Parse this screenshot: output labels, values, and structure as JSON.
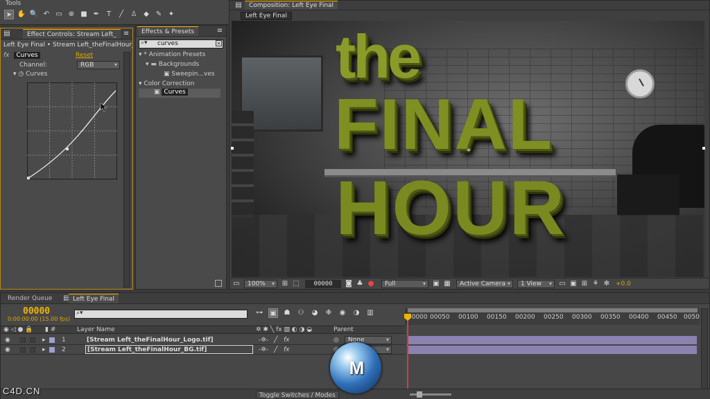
{
  "tools": {
    "title": "Tools",
    "icons": [
      "selection-tool-icon",
      "hand-tool-icon",
      "zoom-tool-icon",
      "rotate-tool-icon",
      "camera-tool-icon",
      "pan-behind-tool-icon",
      "rectangle-tool-icon",
      "pen-tool-icon",
      "text-tool-icon",
      "brush-tool-icon",
      "clone-stamp-tool-icon",
      "eraser-tool-icon",
      "roto-brush-tool-icon",
      "puppet-tool-icon"
    ]
  },
  "effect_controls": {
    "tab_label": "Effect Controls: Stream Left_",
    "breadcrumb": "Left Eye Final • Stream Left_theFinalHour_BG",
    "effect_name": "Curves",
    "reset_label": "Reset",
    "channel_label": "Channel:",
    "channel_value": "RGB",
    "curves_label": "Curves"
  },
  "effects_presets": {
    "tab_label": "Effects & Presets",
    "search_value": "curves",
    "tree": [
      {
        "label": "* Animation Presets",
        "level": 0
      },
      {
        "label": "Backgrounds",
        "level": 1
      },
      {
        "label": "Sweepin...ves",
        "level": 2
      },
      {
        "label": "Color Correction",
        "level": 0
      },
      {
        "label": "Curves",
        "level": 1
      }
    ]
  },
  "composition": {
    "tab_label": "Composition: Left Eye Final",
    "sub_tab": "Left Eye Final",
    "scene_text": {
      "line1": "the",
      "line2": "FINAL",
      "line3": "HOUR"
    },
    "footer": {
      "zoom": "100%",
      "timecode": "00000",
      "resolution": "Full",
      "camera": "Active Camera",
      "view": "1 View",
      "exposure": "+0.0"
    }
  },
  "timeline": {
    "tabs": [
      "Render Queue",
      "Left Eye Final"
    ],
    "timecode": "00000",
    "fps_text": "0:00:00:00 (15.00 fps)",
    "column_layer_name": "Layer Name",
    "column_parent": "Parent",
    "ruler_ticks": [
      "00000",
      "00050",
      "00100",
      "00150",
      "00200",
      "00250",
      "00300",
      "00350",
      "00400",
      "00450",
      "0050"
    ],
    "layers": [
      {
        "num": "1",
        "name": "[Stream Left_theFinalHour_Logo.tif]",
        "parent": "None"
      },
      {
        "num": "2",
        "name": "[Stream Left_theFinalHour_BG.tif]",
        "parent": "None"
      }
    ],
    "toggle_label": "Toggle Switches / Modes"
  },
  "watermark": "C4D.CN"
}
